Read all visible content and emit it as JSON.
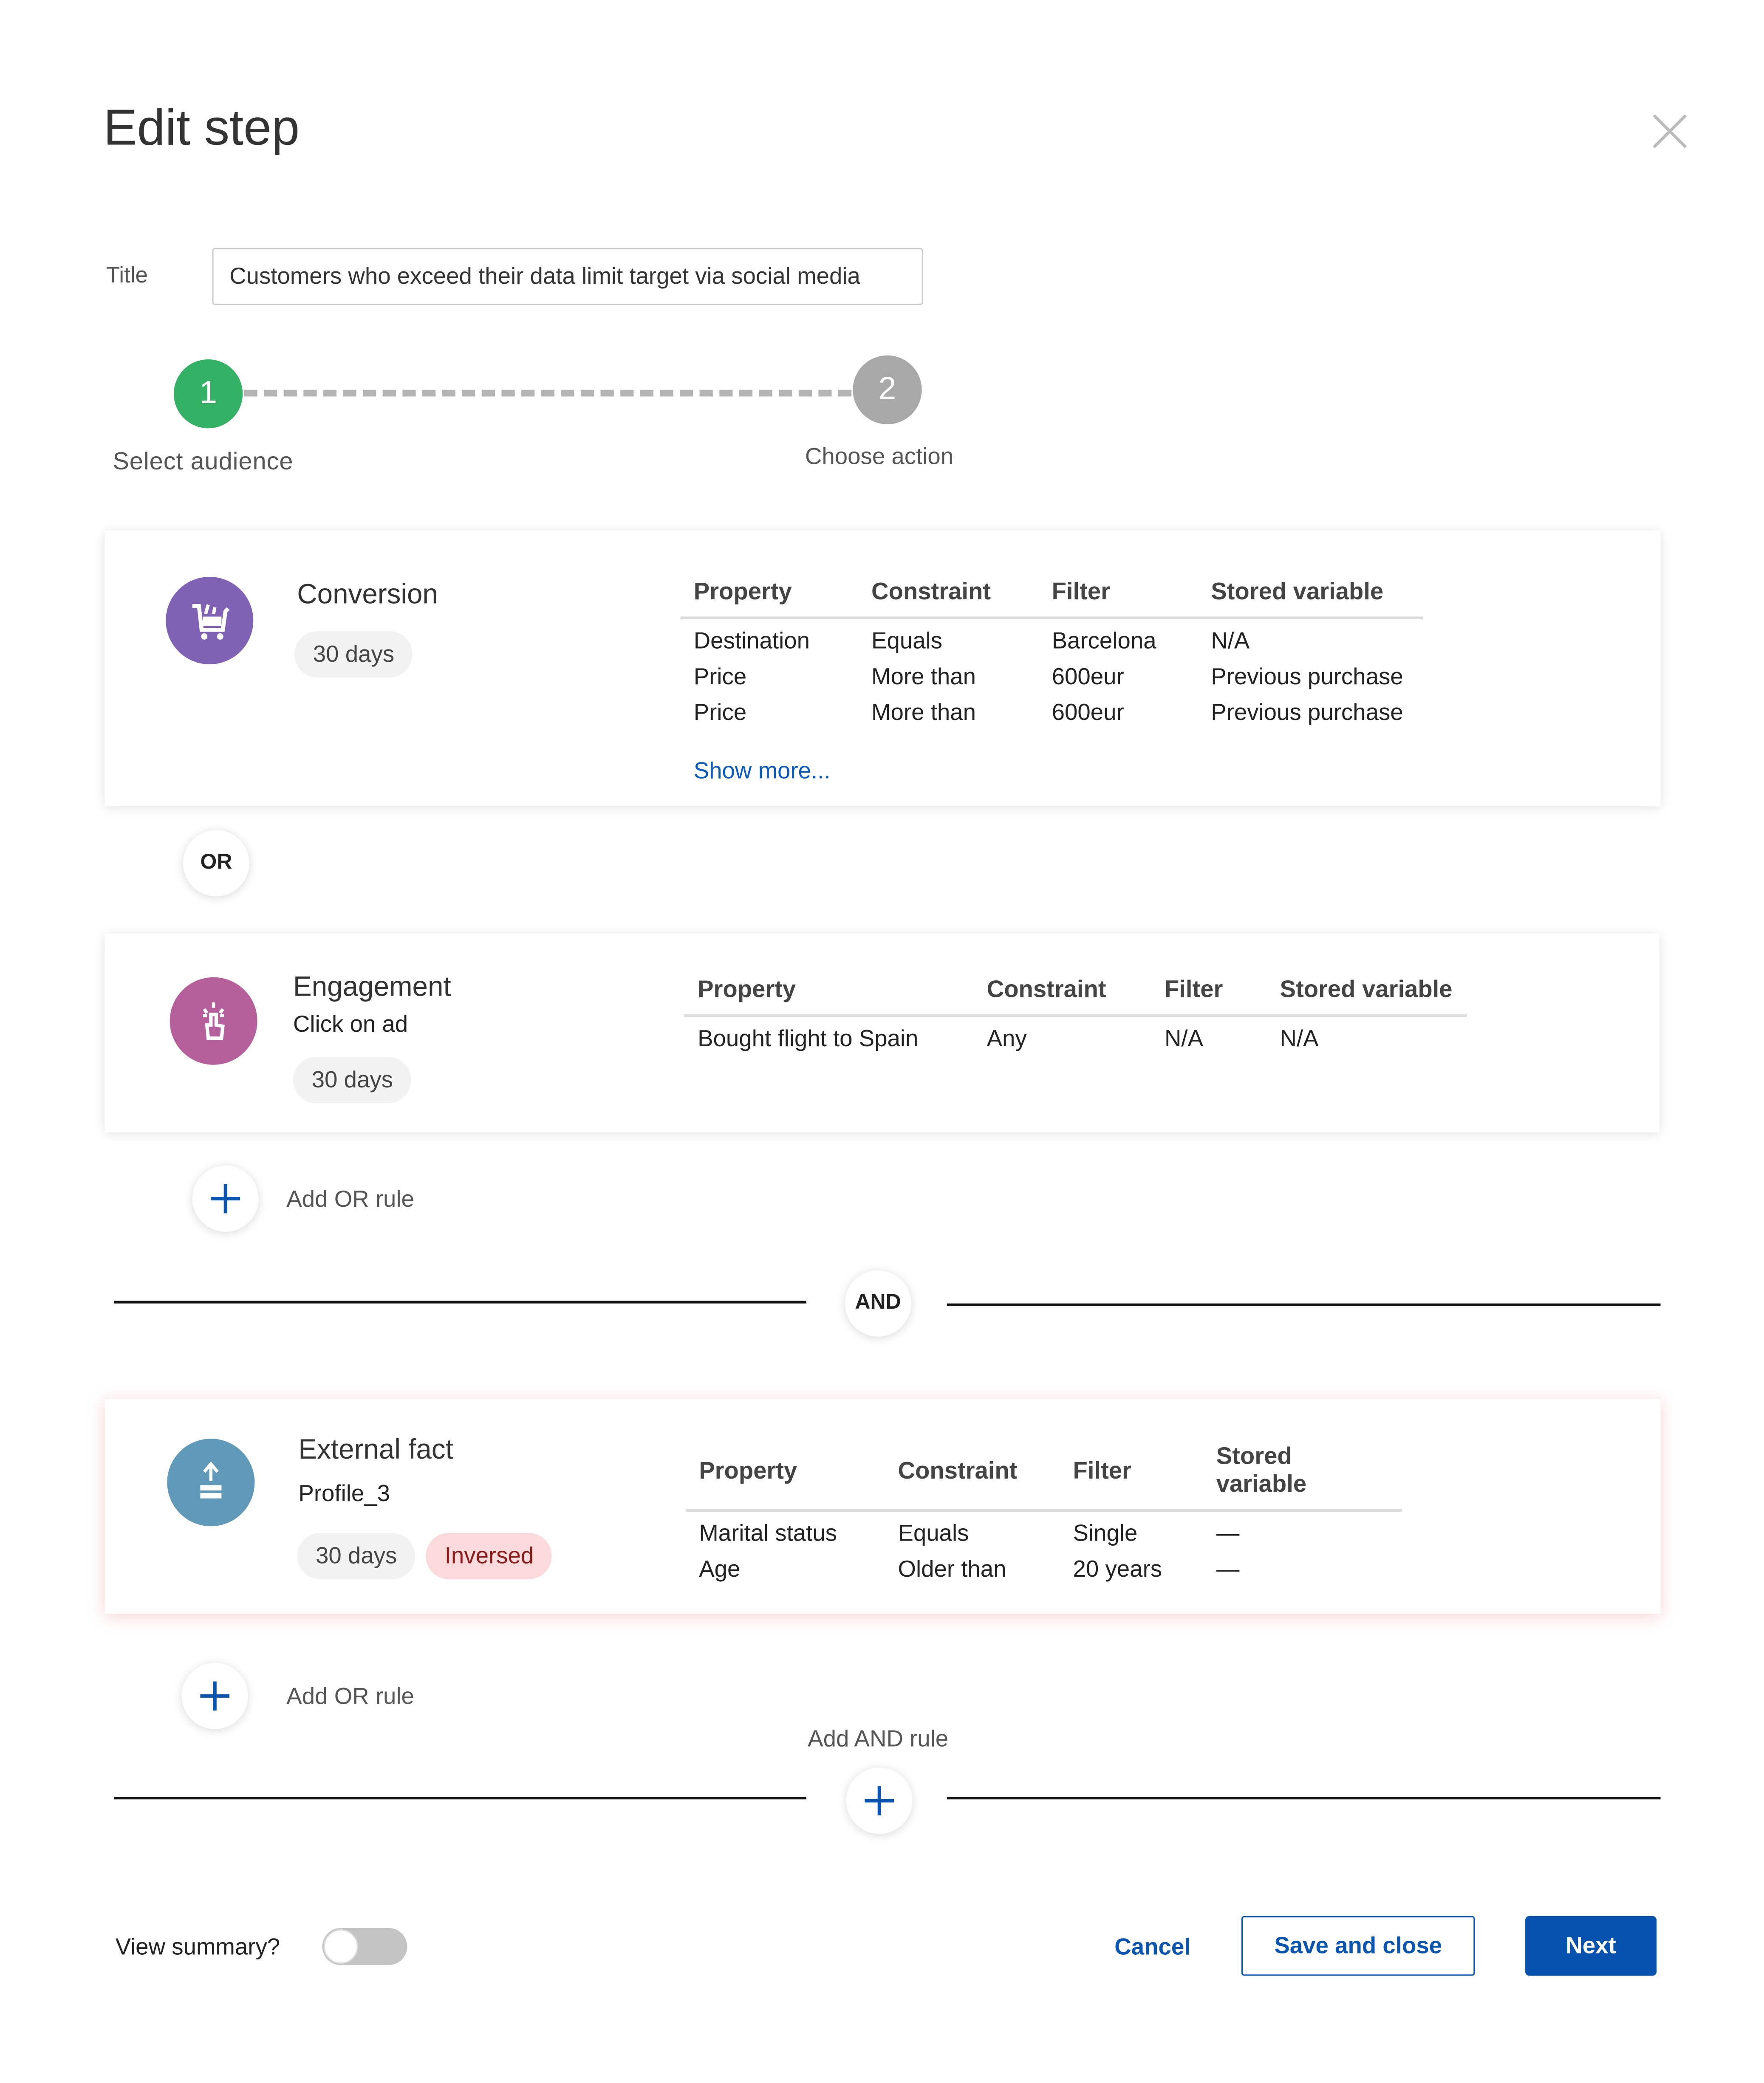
{
  "dialog": {
    "title": "Edit step",
    "close_icon": "close-icon"
  },
  "title_field": {
    "label": "Title",
    "value": "Customers who exceed their data limit target via social media"
  },
  "stepper": {
    "steps": [
      {
        "number": "1",
        "label": "Select audience",
        "status": "active",
        "color": "#33b164"
      },
      {
        "number": "2",
        "label": "Choose action",
        "status": "pending",
        "color": "#a8a8a8"
      }
    ]
  },
  "rules": {
    "columns": [
      "Property",
      "Constraint",
      "Filter",
      "Stored variable"
    ],
    "conversion": {
      "name": "Conversion",
      "icon": "shopping-cart-icon",
      "color": "#8062b5",
      "period": "30 days",
      "rows": [
        [
          "Destination",
          "Equals",
          "Barcelona",
          "N/A"
        ],
        [
          "Price",
          "More than",
          "600eur",
          "Previous purchase"
        ],
        [
          "Price",
          "More than",
          "600eur",
          "Previous purchase"
        ]
      ],
      "show_more": "Show more..."
    },
    "or_label": "OR",
    "engagement": {
      "name": "Engagement",
      "subtitle": "Click on ad",
      "icon": "tap-icon",
      "color": "#b55f9b",
      "period": "30 days",
      "rows": [
        [
          "Bought flight to Spain",
          "Any",
          "N/A",
          "N/A"
        ]
      ]
    },
    "add_or_rule": "Add OR rule",
    "and_label": "AND",
    "external_fact": {
      "name": "External fact",
      "subtitle": "Profile_3",
      "icon": "upload-data-icon",
      "color": "#6199b8",
      "period": "30 days",
      "inversed": "Inversed",
      "rows": [
        [
          "Marital status",
          "Equals",
          "Single",
          "—"
        ],
        [
          "Age",
          "Older than",
          "20 years",
          "—"
        ]
      ]
    },
    "add_and_rule": "Add AND rule"
  },
  "footer": {
    "view_summary_label": "View summary?",
    "view_summary_on": false,
    "cancel": "Cancel",
    "save_and_close": "Save and close",
    "next": "Next",
    "accent": "#0652ad"
  }
}
